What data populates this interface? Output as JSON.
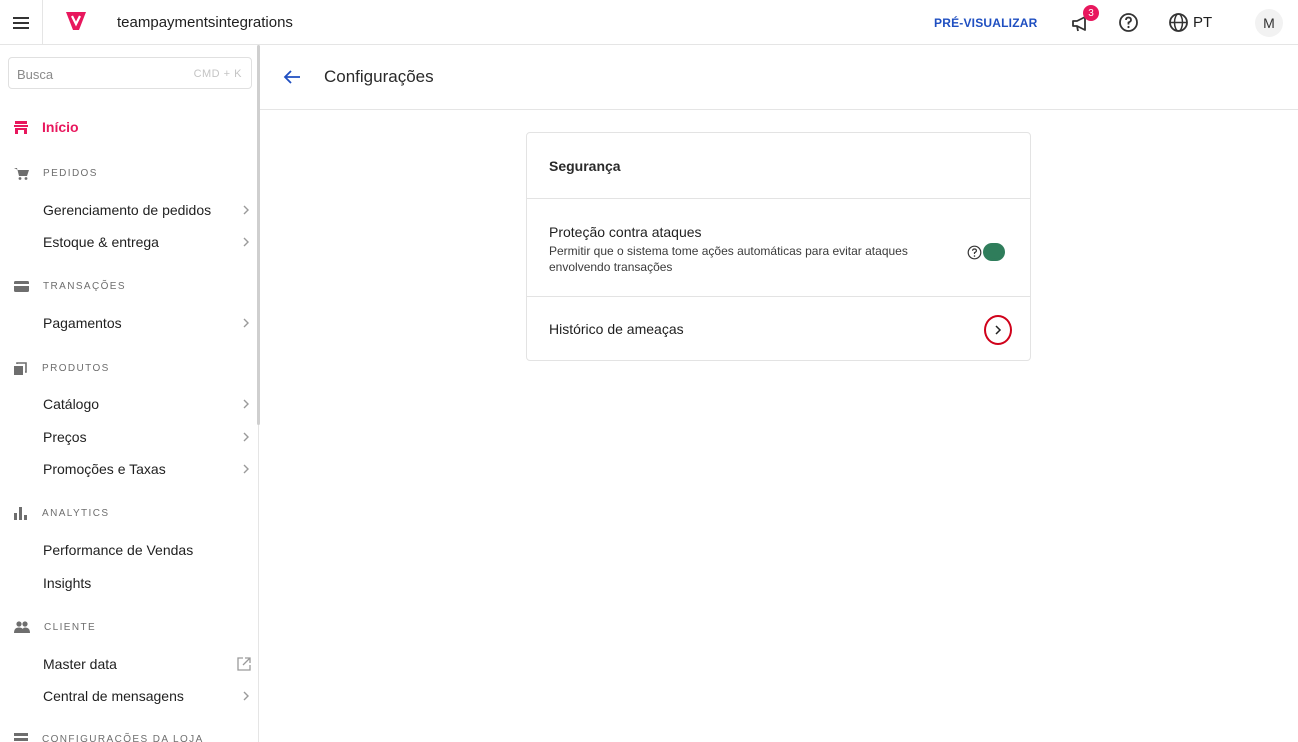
{
  "topbar": {
    "account_name": "teampayments­integrations",
    "preview_label": "PRÉ-VISUALIZAR",
    "notification_count": "3",
    "language": "PT",
    "avatar_initial": "M",
    "brand_color": "#e8175d"
  },
  "sidebar": {
    "search_placeholder": "Busca",
    "search_shortcut": "CMD + K",
    "home_label": "Início",
    "sections": [
      {
        "title": "PEDIDOS",
        "icon": "cart-icon",
        "items": [
          "Gerenciamento de pedidos",
          "Estoque & entrega"
        ]
      },
      {
        "title": "TRANSAÇÕES",
        "icon": "card-icon",
        "items": [
          "Pagamentos"
        ]
      },
      {
        "title": "PRODUTOS",
        "icon": "products-icon",
        "items": [
          "Catálogo",
          "Preços",
          "Promoções e Taxas"
        ]
      },
      {
        "title": "ANALYTICS",
        "icon": "bar-chart-icon",
        "items": [
          "Performance de Vendas",
          "Insights"
        ]
      },
      {
        "title": "CLIENTE",
        "icon": "people-icon",
        "items": [
          "Master data",
          "Central de mensagens"
        ]
      },
      {
        "title": "CONFIGURAÇÕES DA LOJA",
        "icon": "store-settings-icon",
        "items": []
      }
    ]
  },
  "main": {
    "page_title": "Configurações",
    "card": {
      "title": "Segurança",
      "protection_title": "Proteção contra ataques",
      "protection_desc": "Permitir que o sistema tome ações automáticas para evitar ataques envolvendo transações",
      "protection_enabled": true,
      "history_title": "Histórico de ameaças"
    }
  }
}
